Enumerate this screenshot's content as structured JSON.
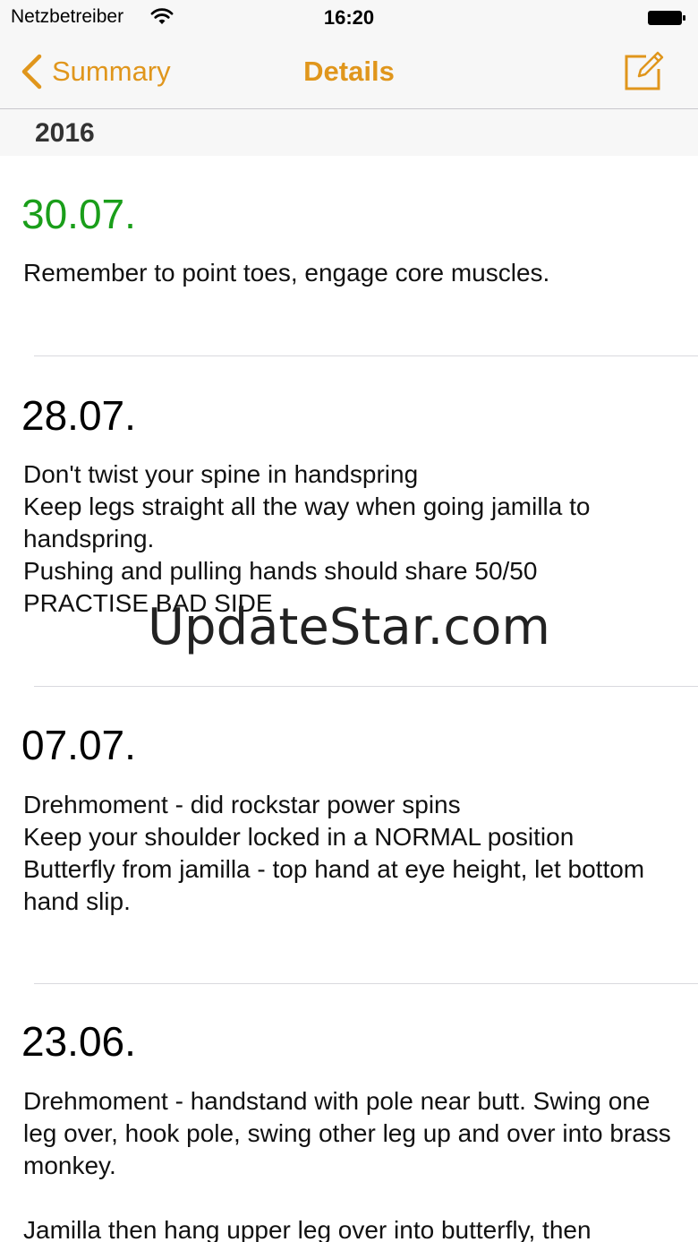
{
  "status_bar": {
    "carrier": "Netzbetreiber",
    "time": "16:20",
    "icons": [
      "wifi-icon",
      "battery-icon"
    ]
  },
  "nav": {
    "back_label": "Summary",
    "title": "Details",
    "back_icon": "chevron-left-icon",
    "action_icon": "compose-icon",
    "accent_color": "#e0961c"
  },
  "section": {
    "year": "2016"
  },
  "entries": [
    {
      "date": "30.07.",
      "date_color": "#1a9e1a",
      "text": "Remember to point toes, engage core muscles."
    },
    {
      "date": "28.07.",
      "date_color": "#000000",
      "text": "Don't twist your spine in handspring\nKeep legs straight all the way when going jamilla to handspring.\nPushing and pulling hands should share 50/50\nPRACTISE BAD SIDE"
    },
    {
      "date": "07.07.",
      "date_color": "#000000",
      "text": "Drehmoment - did rockstar power spins\nKeep your shoulder locked in a NORMAL position\nButterfly from jamilla - top hand at eye height, let bottom hand slip."
    },
    {
      "date": "23.06.",
      "date_color": "#000000",
      "text": "Drehmoment - handstand with pole near butt. Swing one leg over, hook pole, swing other leg up and over into brass monkey.\n\nJamilla then hang upper leg over into butterfly, then"
    }
  ],
  "watermark": "UpdateStar.com"
}
